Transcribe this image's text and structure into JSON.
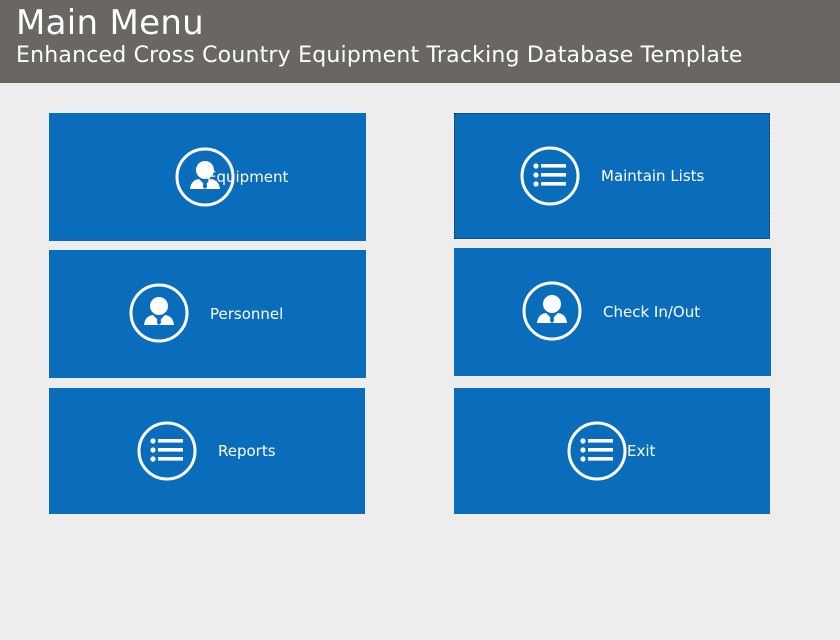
{
  "header": {
    "title": "Main Menu",
    "subtitle": "Enhanced Cross Country Equipment Tracking Database Template"
  },
  "tiles": [
    {
      "label": "Equipment",
      "icon": "person-icon"
    },
    {
      "label": "Maintain Lists",
      "icon": "list-icon"
    },
    {
      "label": "Personnel",
      "icon": "person-icon"
    },
    {
      "label": "Check In/Out",
      "icon": "person-icon"
    },
    {
      "label": "Reports",
      "icon": "list-icon"
    },
    {
      "label": "Exit",
      "icon": "list-icon"
    }
  ],
  "colors": {
    "header_bg": "#6a6661",
    "tile_bg": "#0a6dbb",
    "page_bg": "#ededed"
  }
}
